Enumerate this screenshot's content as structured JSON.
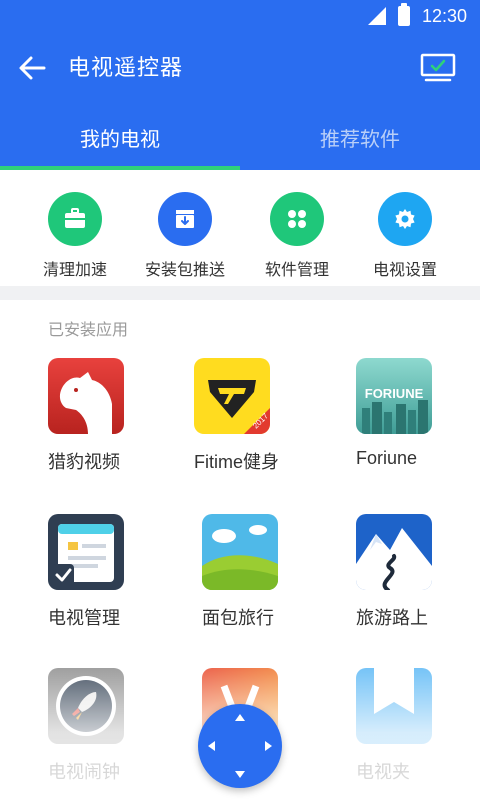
{
  "status_bar": {
    "time": "12:30"
  },
  "app_bar": {
    "title": "电视遥控器"
  },
  "tabs": [
    {
      "label": "我的电视",
      "active": true
    },
    {
      "label": "推荐软件",
      "active": false
    }
  ],
  "quick_actions": [
    {
      "label": "清理加速",
      "icon": "toolbox-icon",
      "color": "#1fc77a"
    },
    {
      "label": "安装包推送",
      "icon": "install-push-icon",
      "color": "#2a6df0"
    },
    {
      "label": "软件管理",
      "icon": "apps-grid-icon",
      "color": "#1fc77a"
    },
    {
      "label": "电视设置",
      "icon": "gear-icon",
      "color": "#1ea6f2"
    }
  ],
  "installed_section": {
    "title": "已安装应用"
  },
  "apps": [
    {
      "name": "猎豹视频",
      "icon": "cheetah-video-icon"
    },
    {
      "name": "Fitime健身",
      "icon": "fitime-icon",
      "badge_text": "2017"
    },
    {
      "name": "Foriune",
      "icon": "foriune-icon",
      "icon_text": "FORIUNE"
    },
    {
      "name": "电视管理",
      "icon": "tv-manager-icon"
    },
    {
      "name": "面包旅行",
      "icon": "bread-travel-icon"
    },
    {
      "name": "旅游路上",
      "icon": "travel-road-icon"
    },
    {
      "name": "电视闹钟",
      "icon": "tv-alarm-icon"
    },
    {
      "name": "",
      "icon": "v-app-icon"
    },
    {
      "name": "电视夹",
      "icon": "tv-folder-icon"
    }
  ],
  "colors": {
    "primary": "#2a6df0",
    "tab_indicator": "#2fd17a",
    "inactive_tab_text": "#b9cff8"
  }
}
